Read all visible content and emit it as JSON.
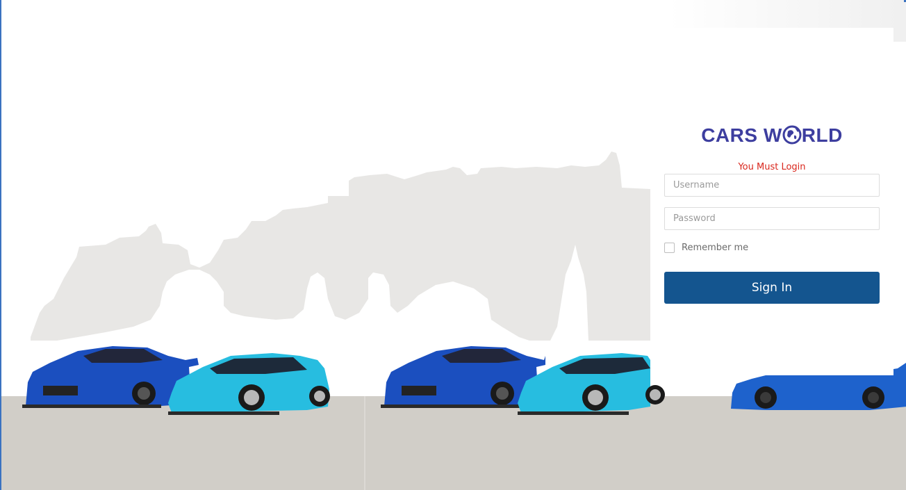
{
  "brand": {
    "logo_left": "CARS W",
    "logo_right": "RLD",
    "logo_color": "#3d3e9f"
  },
  "login": {
    "message": "You Must Login",
    "message_color": "#d9261c",
    "username_placeholder": "Username",
    "username_value": "",
    "password_placeholder": "Password",
    "password_value": "",
    "remember_label": "Remember me",
    "remember_checked": false,
    "signin_label": "Sign In",
    "button_color": "#14558f"
  },
  "scene": {
    "skyline_color": "#e8e7e5",
    "ground_color": "#d1cec8",
    "car_colors": [
      "#1b4fbf",
      "#27bde0",
      "#1b4fbf",
      "#27bde0",
      "#1e62cc"
    ]
  },
  "icons": [
    "globe-icon",
    "checkbox-icon"
  ]
}
